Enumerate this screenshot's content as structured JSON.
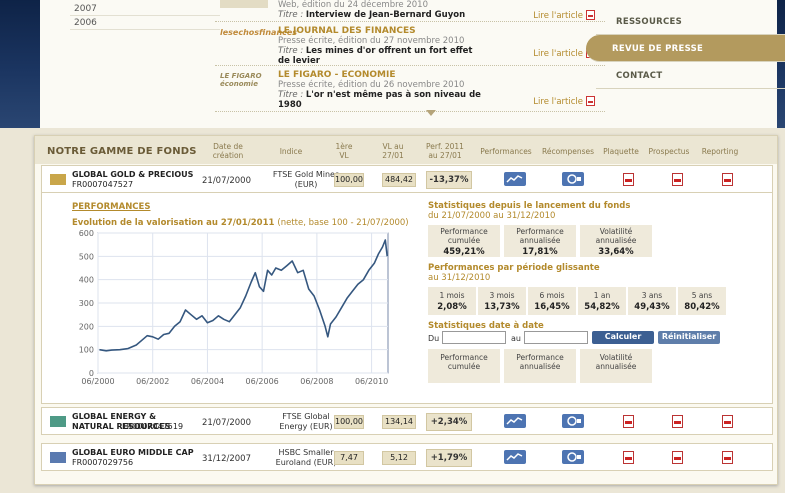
{
  "years": [
    "2007",
    "2006"
  ],
  "press": [
    {
      "logo": "",
      "title": "",
      "line1": "Web, édition du 24 décembre 2010",
      "titre_label": "Titre :",
      "titre": "Interview de Jean-Bernard Guyon",
      "lire": "Lire l'article"
    },
    {
      "logo": "lesechosfinances",
      "title": "LE JOURNAL DES FINANCES",
      "line1": "Presse écrite, édition du 27 novembre 2010",
      "titre_label": "Titre :",
      "titre": "Les mines d'or offrent un fort effet de levier",
      "lire": "Lire l'article"
    },
    {
      "logo": "LE FIGARO économie",
      "title": "LE FIGARO - ECONOMIE",
      "line1": "Presse écrite, édition du 26 novembre 2010",
      "titre_label": "Titre :",
      "titre": "L'or n'est même pas à son niveau de 1980",
      "lire": "Lire l'article"
    }
  ],
  "nav": [
    "RESSOURCES",
    "REVUE DE PRESSE",
    "CONTACT"
  ],
  "header": {
    "title": "NOTRE GAMME DE FONDS",
    "cols": [
      "Date de création",
      "Indice",
      "1ère VL",
      "VL au 27/01",
      "Perf. 2011 au 27/01",
      "Performances",
      "Récompenses",
      "Plaquette",
      "Prospectus",
      "Reporting"
    ]
  },
  "funds": [
    {
      "name": "GLOBAL GOLD & PRECIOUS",
      "code": "FR0007047527",
      "date": "21/07/2000",
      "index": "FTSE Gold Mines (EUR)",
      "vl1": "100,00",
      "vl": "484,42",
      "perf": "-13,37%",
      "color": "#c9a64a"
    },
    {
      "name": "GLOBAL ENERGY & NATURAL RESOURCES",
      "code": "FR0007047519",
      "date": "21/07/2000",
      "index": "FTSE Global Energy (EUR)",
      "vl1": "100,00",
      "vl": "134,14",
      "perf": "+2,34%",
      "color": "#4e9a86"
    },
    {
      "name": "GLOBAL EURO MIDDLE CAP",
      "code": "FR0007029756",
      "date": "31/12/2007",
      "index": "HSBC Smaller Euroland (EUR)",
      "vl1": "7,47",
      "vl": "5,12",
      "perf": "+1,79%",
      "color": "#5a7ab0"
    }
  ],
  "detail": {
    "perf_heading": "PERFORMANCES",
    "evol_title": "Evolution de la valorisation au 27/01/2011",
    "evol_sub": "(nette, base 100 - 21/07/2000)",
    "stats_title": "Statistiques depuis le lancement du fonds",
    "stats_sub": "du 21/07/2000 au 31/12/2010",
    "stats": [
      {
        "label": "Performance cumulée",
        "value": "459,21%"
      },
      {
        "label": "Performance annualisée",
        "value": "17,81%"
      },
      {
        "label": "Volatilité annualisée",
        "value": "33,64%"
      }
    ],
    "glis_title": "Performances par période glissante",
    "glis_sub": "au 31/12/2010",
    "glis": [
      {
        "label": "1 mois",
        "value": "2,08%"
      },
      {
        "label": "3 mois",
        "value": "13,73%"
      },
      {
        "label": "6 mois",
        "value": "16,45%"
      },
      {
        "label": "1 an",
        "value": "54,82%"
      },
      {
        "label": "3 ans",
        "value": "49,43%"
      },
      {
        "label": "5 ans",
        "value": "80,42%"
      }
    ],
    "date_title": "Statistiques date à date",
    "du": "Du",
    "au": "au",
    "calc": "Calculer",
    "reset": "Réinitialiser",
    "stats2": [
      "Performance cumulée",
      "Performance annualisée",
      "Volatilité annualisée"
    ]
  },
  "chart_data": {
    "type": "line",
    "title": "",
    "xlabel": "",
    "ylabel": "",
    "xlim": [
      2000.5,
      2011.1
    ],
    "ylim": [
      0,
      600
    ],
    "yticks": [
      0,
      100,
      200,
      300,
      400,
      500,
      600
    ],
    "xticks": [
      "06/2000",
      "06/2002",
      "06/2004",
      "06/2006",
      "06/2008",
      "06/2010"
    ],
    "color": "#35577f",
    "grid": true,
    "x": [
      2000.55,
      2000.8,
      2001.0,
      2001.3,
      2001.6,
      2001.9,
      2002.1,
      2002.3,
      2002.5,
      2002.7,
      2002.9,
      2003.1,
      2003.3,
      2003.5,
      2003.7,
      2003.9,
      2004.1,
      2004.3,
      2004.5,
      2004.7,
      2004.9,
      2005.1,
      2005.3,
      2005.5,
      2005.7,
      2005.9,
      2006.1,
      2006.25,
      2006.4,
      2006.55,
      2006.7,
      2006.85,
      2007.0,
      2007.2,
      2007.4,
      2007.6,
      2007.8,
      2008.0,
      2008.2,
      2008.4,
      2008.6,
      2008.8,
      2008.9,
      2009.0,
      2009.2,
      2009.4,
      2009.6,
      2009.8,
      2010.0,
      2010.2,
      2010.4,
      2010.6,
      2010.75,
      2010.9,
      2011.0,
      2011.07
    ],
    "y": [
      100,
      95,
      98,
      100,
      105,
      120,
      140,
      160,
      155,
      145,
      165,
      170,
      200,
      220,
      270,
      250,
      230,
      245,
      215,
      225,
      245,
      230,
      220,
      250,
      280,
      330,
      390,
      430,
      370,
      350,
      440,
      420,
      450,
      440,
      460,
      480,
      430,
      440,
      360,
      330,
      270,
      200,
      155,
      210,
      240,
      280,
      320,
      350,
      380,
      400,
      440,
      470,
      510,
      540,
      570,
      500
    ]
  }
}
